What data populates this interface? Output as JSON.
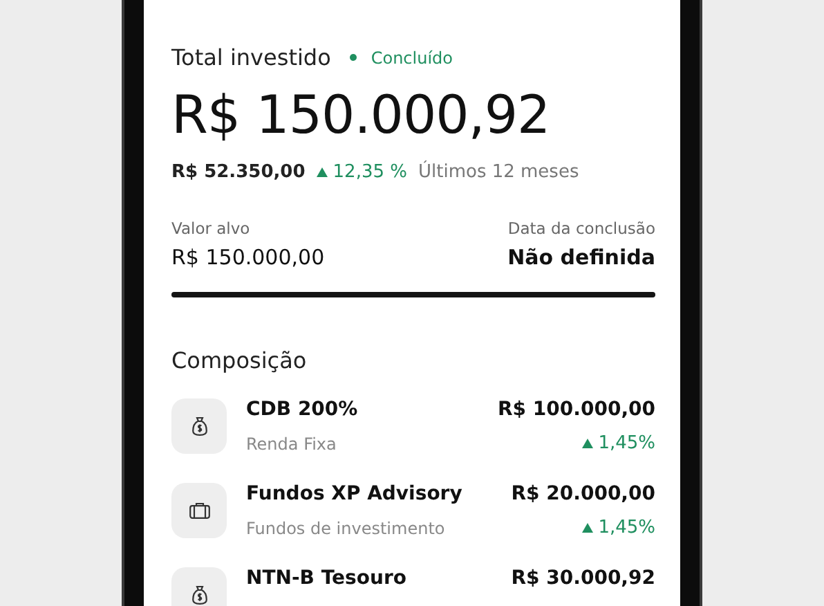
{
  "summary": {
    "title": "Total investido",
    "status": {
      "label": "Concluído",
      "color": "#1f8f5f"
    },
    "amount": "R$ 150.000,92",
    "gain": "R$ 52.350,00",
    "change": "12,35 %",
    "trend_up": true,
    "period": "Últimos 12 meses"
  },
  "goal": {
    "target_label": "Valor alvo",
    "target_value": "R$ 150.000,00",
    "date_label": "Data da conclusão",
    "date_value": "Não definida",
    "level": 1
  },
  "composition": {
    "title": "Composição",
    "items": [
      {
        "kind": "bag",
        "name": "CDB 200%",
        "category": "Renda Fixa",
        "value": "R$ 100.000,00",
        "change": "1,45%",
        "trend_up": true
      },
      {
        "kind": "briefcase",
        "name": "Fundos XP Advisory",
        "category": "Fundos de investimento",
        "value": "R$ 20.000,00",
        "change": "1,45%",
        "trend_up": true
      },
      {
        "kind": "bag",
        "name": "NTN-B Tesouro",
        "value": "R$ 30.000,92"
      }
    ]
  }
}
